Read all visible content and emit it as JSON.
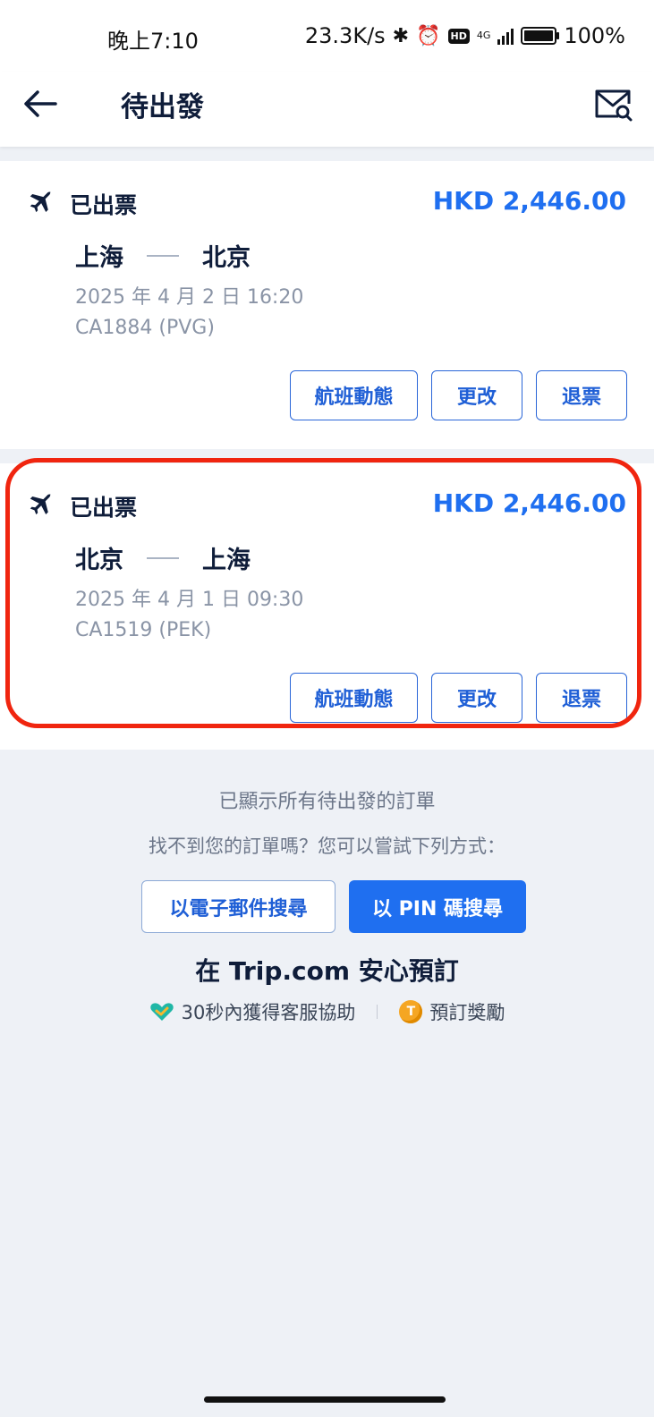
{
  "status_bar": {
    "time": "晚上7:10",
    "network_speed": "23.3K/s",
    "network_type": "4G",
    "hd": "HD",
    "battery": "100%"
  },
  "header": {
    "title": "待出發",
    "back_icon": "arrow-left-icon",
    "mail_icon": "mail-search-icon"
  },
  "orders": [
    {
      "status": "已出票",
      "price": "HKD 2,446.00",
      "from": "上海",
      "to": "北京",
      "datetime": "2025 年 4 月 2 日 16:20",
      "flight": "CA1884 (PVG)",
      "actions": {
        "status": "航班動態",
        "change": "更改",
        "refund": "退票"
      }
    },
    {
      "status": "已出票",
      "price": "HKD 2,446.00",
      "from": "北京",
      "to": "上海",
      "datetime": "2025 年 4 月 1 日 09:30",
      "flight": "CA1519 (PEK)",
      "actions": {
        "status": "航班動態",
        "change": "更改",
        "refund": "退票"
      }
    }
  ],
  "footer": {
    "all_shown": "已顯示所有待出發的訂單",
    "not_found": "找不到您的訂單嗎？您可以嘗試下列方式：",
    "email_search": "以電子郵件搜尋",
    "pin_search": "以 PIN 碼搜尋",
    "safe_title": "在 Trip.com 安心預訂",
    "perk_support": "30秒內獲得客服協助",
    "perk_rewards": "預訂獎勵"
  },
  "colors": {
    "accent": "#1f6ff0",
    "highlight": "#f0250f",
    "text_dark": "#0f1d3a",
    "text_muted": "#8a94a6"
  }
}
